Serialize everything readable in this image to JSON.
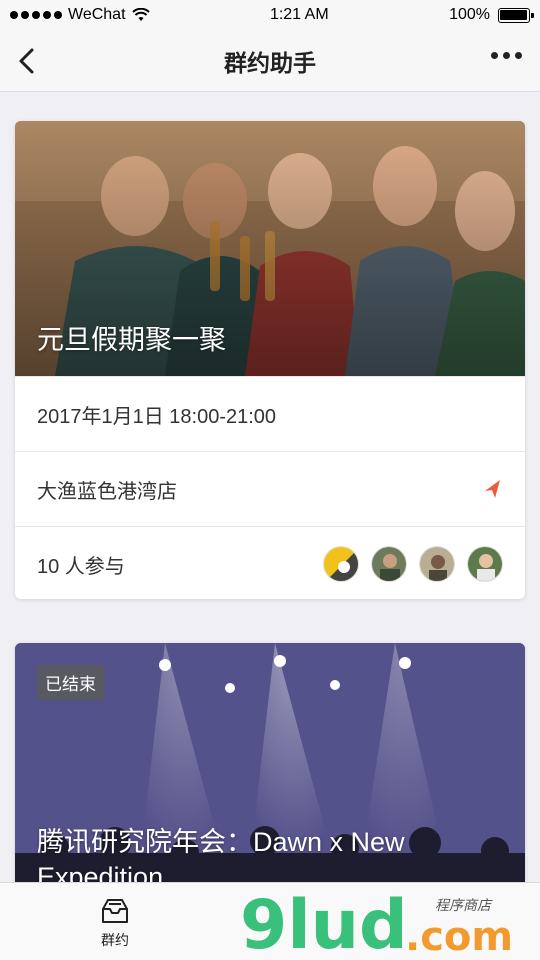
{
  "status_bar": {
    "carrier": "WeChat",
    "time": "1:21 AM",
    "battery": "100%"
  },
  "nav": {
    "title": "群约助手"
  },
  "events": [
    {
      "title": "元旦假期聚一聚",
      "datetime": "2017年1月1日 18:00-21:00",
      "location": "大渔蓝色港湾店",
      "participants": "10 人参与"
    },
    {
      "badge": "已结束",
      "title_line1": "腾讯研究院年会：Dawn x New",
      "title_line2": "Expedition"
    }
  ],
  "tab_bar": {
    "items": [
      {
        "label": "群约"
      }
    ]
  },
  "watermark": {
    "brand": "9lud",
    "suffix": ".com",
    "tagline": "程序商店"
  },
  "colors": {
    "accent": "#f05a3c",
    "watermark_green": "#39c07a",
    "watermark_orange": "#f29a2e"
  }
}
